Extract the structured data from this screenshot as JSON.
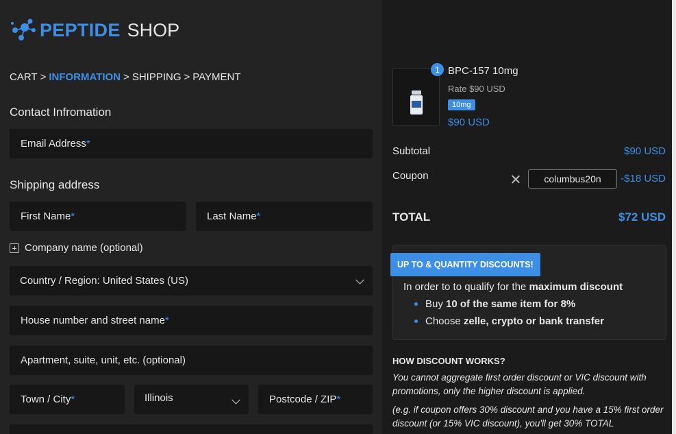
{
  "brand": {
    "name": "PEPTIDE",
    "suffix": "SHOP",
    "accent": "#3d8fe6"
  },
  "breadcrumb": [
    {
      "label": "CART",
      "active": false
    },
    {
      "label": "INFORMATION",
      "active": true
    },
    {
      "label": "SHIPPING",
      "active": false
    },
    {
      "label": "PAYMENT",
      "active": false
    }
  ],
  "contact": {
    "title": "Contact Infromation",
    "email_label": "Email Address",
    "required_mark": "*"
  },
  "shipping": {
    "title": "Shipping address",
    "first_name": "First Name",
    "last_name": "Last Name",
    "company": "Company name (optional)",
    "country": "Country / Region: United States (US)",
    "street": "House number and street name",
    "apartment": "Apartment, suite, unit, etc. (optional)",
    "town": "Town / City",
    "state": "Illinois",
    "postcode": "Postcode / ZIP"
  },
  "order": {
    "item": {
      "quantity": "1",
      "name": "BPC-157 10mg",
      "rate": "Rate $90 USD",
      "variant": "10mg",
      "price": "$90 USD"
    },
    "subtotal_label": "Subtotal",
    "subtotal_value": "$90 USD",
    "coupon_label": "Coupon",
    "coupon_code": "columbus20n",
    "coupon_discount": "-$18 USD",
    "total_label": "TOTAL",
    "total_value": "$72 USD"
  },
  "discounts": {
    "title": "UP TO & QUANTITY DISCOUNTS!",
    "intro_pre": "In order to to qualify for the ",
    "intro_bold": "maximum discount",
    "bullets": [
      {
        "pre": "Buy ",
        "bold": "10 of the same item for 8%"
      },
      {
        "pre": "Choose ",
        "bold": "zelle, crypto or bank transfer"
      }
    ],
    "how_title": "HOW DISCOUNT WORKS?",
    "how_text": "You cannot aggregate first order discount or VIC discount with promotions, only the higher discount is applied.",
    "how_example": "(e.g. if coupon offers 30% discount and you have a 15% first order discount (or 15% VIC discount), you'll get 30% TOTAL"
  }
}
